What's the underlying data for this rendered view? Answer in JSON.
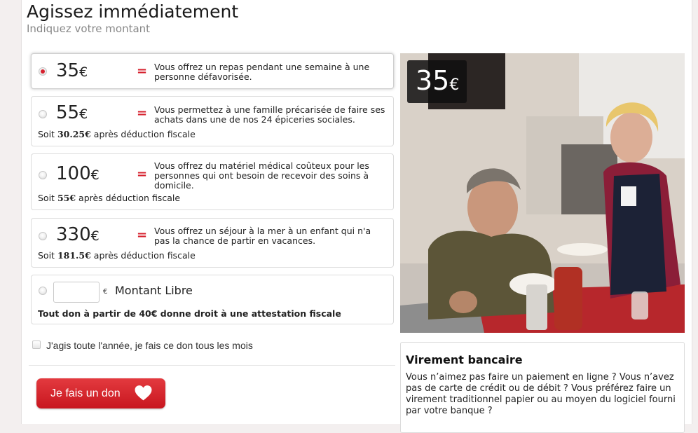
{
  "header": {
    "title": "Agissez immédiatement",
    "subtitle": "Indiquez votre montant"
  },
  "currency_symbol": "€",
  "equals_sign": "=",
  "options": [
    {
      "amount": "35",
      "description": "Vous offrez un repas pendant une semaine à une personne défavorisée.",
      "selected": true
    },
    {
      "amount": "55",
      "description": "Vous permettez à une famille précarisée de faire ses achats dans une de nos 24 épiceries sociales.",
      "deduction_prefix": "Soit",
      "deduction_value": "30.25€",
      "deduction_suffix": "après déduction fiscale"
    },
    {
      "amount": "100",
      "description": "Vous offrez du matériel médical coûteux pour les personnes qui ont besoin de recevoir des soins à domicile.",
      "deduction_prefix": "Soit",
      "deduction_value": "55€",
      "deduction_suffix": "après déduction fiscale"
    },
    {
      "amount": "330",
      "description": "Vous offrez un séjour à la mer à un enfant qui n'a pas la chance de partir en vacances.",
      "deduction_prefix": "Soit",
      "deduction_value": "181.5€",
      "deduction_suffix": "après déduction fiscale"
    }
  ],
  "free_amount": {
    "value": "",
    "currency": "€",
    "label": "Montant Libre",
    "note": "Tout don à partir de 40€ donne droit à une attestation fiscale"
  },
  "monthly": {
    "label": "J'agis toute l'année, je fais ce don tous les mois",
    "checked": false
  },
  "donate_button": {
    "label": "Je fais un don",
    "icon": "heart-icon"
  },
  "photo_badge": {
    "amount": "35",
    "currency": "€"
  },
  "bank_transfer": {
    "title": "Virement bancaire",
    "text": "Vous n’aimez pas faire un paiement en ligne ? Vous n’avez pas de carte de crédit ou de débit ? Vous préférez faire un virement traditionnel papier ou au moyen du logiciel fourni par votre banque ?"
  },
  "colors": {
    "accent_red": "#d6212e",
    "button_red": "#c8161f",
    "subtitle_gray": "#888888"
  }
}
